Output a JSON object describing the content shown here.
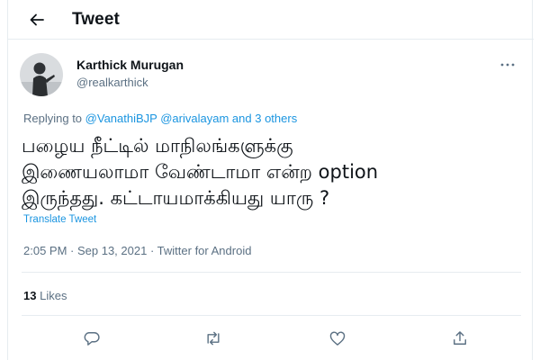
{
  "header": {
    "title": "Tweet",
    "back_icon": "back-arrow-icon"
  },
  "tweet": {
    "author_name": "Karthick Murugan",
    "author_handle": "@realkarthick",
    "replying": {
      "prefix": "Replying to",
      "mention1": "@VanathiBJP",
      "mention2": "@arivalayam",
      "others": "and 3 others"
    },
    "text_lines": [
      "பழைய நீட்டில் மாநிலங்களுக்கு",
      "இணையலாமா வேண்டாமா என்ற option",
      "இருந்தது.  கட்டாயமாக்கியது யாரு ?"
    ],
    "translate_label": "Translate Tweet",
    "time": "2:05 PM",
    "date": "Sep 13, 2021",
    "source": "Twitter for Android",
    "separator": " · ",
    "likes_count": "13",
    "likes_label": "Likes"
  },
  "actions": {
    "icons": [
      "reply-icon",
      "retweet-icon",
      "like-icon",
      "share-icon"
    ]
  },
  "colors": {
    "accent": "#1b95e0",
    "secondary_text": "#5b7083",
    "border": "#e6ecf0"
  }
}
